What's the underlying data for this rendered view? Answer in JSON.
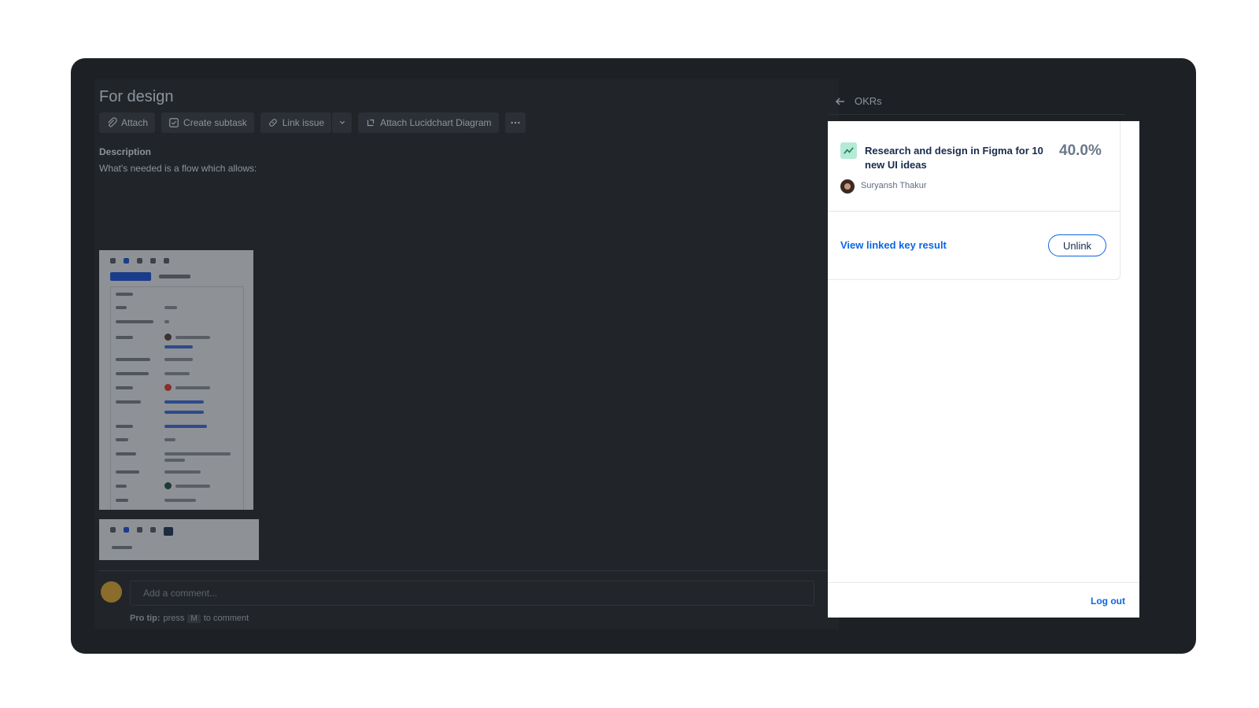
{
  "issue": {
    "title": "For design",
    "toolbar": {
      "attach": "Attach",
      "create_subtask": "Create subtask",
      "link_issue": "Link issue",
      "attach_lucidchart": "Attach Lucidchart Diagram"
    },
    "description_label": "Description",
    "description_text": "What's needed is a flow which allows:"
  },
  "comment": {
    "placeholder": "Add a comment...",
    "pro_tip_label": "Pro tip:",
    "pro_tip_press": "press",
    "pro_tip_key": "M",
    "pro_tip_suffix": "to comment"
  },
  "okr_panel": {
    "header_title": "OKRs",
    "key_result": {
      "title": "Research and design in Figma for 10 new UI ideas",
      "progress": "40.0%",
      "owner": "Suryansh Thakur"
    },
    "view_link": "View linked key result",
    "unlink_button": "Unlink",
    "logout": "Log out"
  },
  "colors": {
    "background_dark": "#1d2125",
    "link_blue": "#0c66e4",
    "kr_icon_bg": "#b5ead7",
    "kr_icon_line": "#1f845a"
  }
}
